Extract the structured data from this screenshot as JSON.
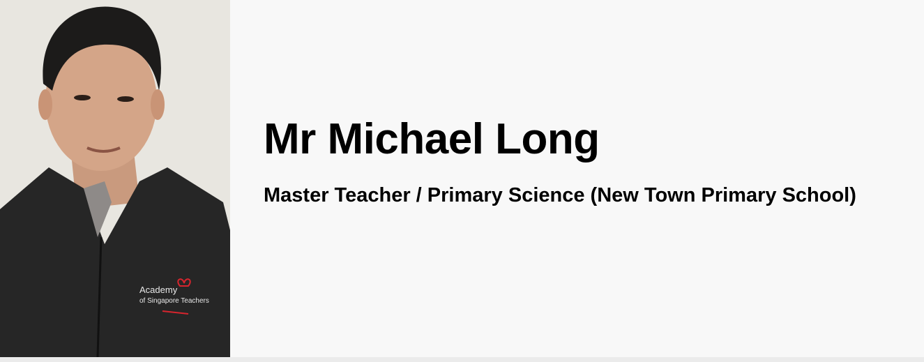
{
  "profile": {
    "name": "Mr Michael Long",
    "title": "Master Teacher / Primary Science (New Town Primary School)",
    "photo_logo_text": "Academy of Singapore Teachers"
  }
}
